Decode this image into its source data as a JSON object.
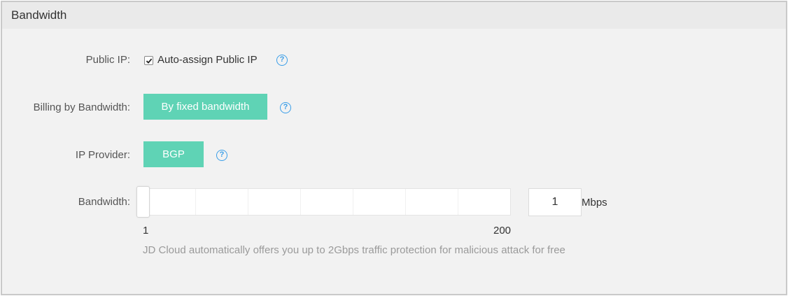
{
  "panel": {
    "title": "Bandwidth"
  },
  "public_ip": {
    "label": "Public IP:",
    "checkbox_label": "Auto-assign Public IP",
    "checked": true,
    "help": "?"
  },
  "billing": {
    "label": "Billing by Bandwidth:",
    "option": "By fixed bandwidth",
    "help": "?"
  },
  "provider": {
    "label": "IP Provider:",
    "option": "BGP",
    "help": "?"
  },
  "bandwidth": {
    "label": "Bandwidth:",
    "min": "1",
    "max": "200",
    "value": "1",
    "unit": "Mbps",
    "hint": "JD Cloud automatically offers you up to 2Gbps traffic protection for malicious attack for free"
  },
  "colors": {
    "accent": "#5fd3b5",
    "help_icon": "#3a9ee8"
  }
}
